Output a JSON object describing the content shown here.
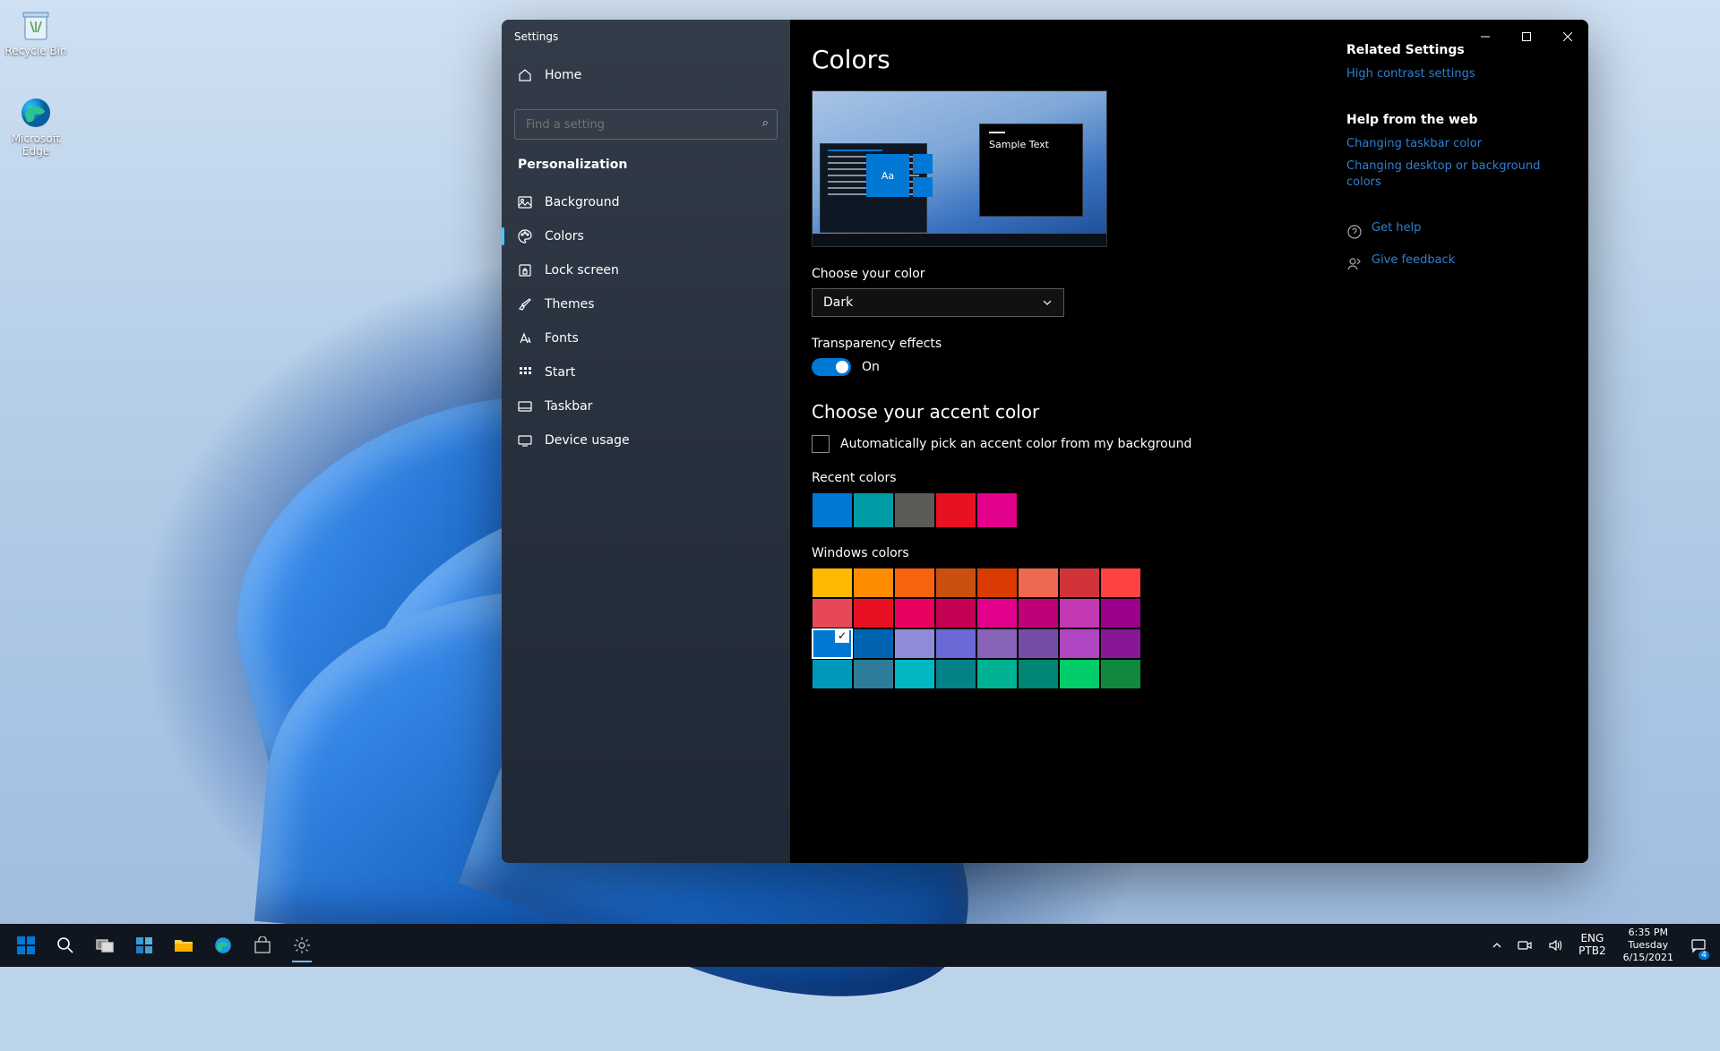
{
  "desktop": {
    "icons": [
      {
        "name": "recycle-bin",
        "label": "Recycle Bin"
      },
      {
        "name": "edge",
        "label": "Microsoft Edge"
      }
    ]
  },
  "window": {
    "title": "Settings",
    "home": "Home",
    "search_placeholder": "Find a setting",
    "sidebar_section": "Personalization",
    "sidebar_items": [
      {
        "label": "Background",
        "icon": "image-icon"
      },
      {
        "label": "Colors",
        "icon": "palette-icon",
        "active": true
      },
      {
        "label": "Lock screen",
        "icon": "lockscreen-icon"
      },
      {
        "label": "Themes",
        "icon": "brush-icon"
      },
      {
        "label": "Fonts",
        "icon": "font-icon"
      },
      {
        "label": "Start",
        "icon": "grid-icon"
      },
      {
        "label": "Taskbar",
        "icon": "taskbar-icon"
      },
      {
        "label": "Device usage",
        "icon": "device-icon"
      }
    ]
  },
  "page": {
    "title": "Colors",
    "preview_sample": "Sample Text",
    "preview_tile": "Aa",
    "choose_color_label": "Choose your color",
    "choose_color_value": "Dark",
    "transparency_label": "Transparency effects",
    "transparency_state": "On",
    "accent_title": "Choose your accent color",
    "auto_accent_label": "Automatically pick an accent color from my background",
    "recent_label": "Recent colors",
    "recent_colors": [
      "#0078d4",
      "#009ca6",
      "#5b5b58",
      "#e81123",
      "#e3008c"
    ],
    "windows_label": "Windows colors",
    "windows_colors": [
      "#ffb900",
      "#ff8c00",
      "#f7630c",
      "#ca5010",
      "#da3b01",
      "#ef6950",
      "#d13438",
      "#ff4343",
      "#e74856",
      "#e81123",
      "#ea005e",
      "#c30052",
      "#e3008c",
      "#bf0077",
      "#c239b3",
      "#9a0089",
      "#0078d4",
      "#0063b1",
      "#8e8cd8",
      "#6b69d6",
      "#8764b8",
      "#744da9",
      "#b146c2",
      "#881798",
      "#0099bc",
      "#2d7d9a",
      "#00b7c3",
      "#038387",
      "#00b294",
      "#018574",
      "#00cc6a",
      "#10893e"
    ],
    "selected_color_index": 16
  },
  "aside": {
    "related_title": "Related Settings",
    "related_links": [
      "High contrast settings"
    ],
    "help_title": "Help from the web",
    "help_links": [
      "Changing taskbar color",
      "Changing desktop or background colors"
    ],
    "get_help": "Get help",
    "give_feedback": "Give feedback"
  },
  "taskbar": {
    "tray": {
      "lang1": "ENG",
      "lang2": "PTB2",
      "time": "6:35 PM",
      "day": "Tuesday",
      "date": "6/15/2021",
      "badge": "4"
    }
  }
}
